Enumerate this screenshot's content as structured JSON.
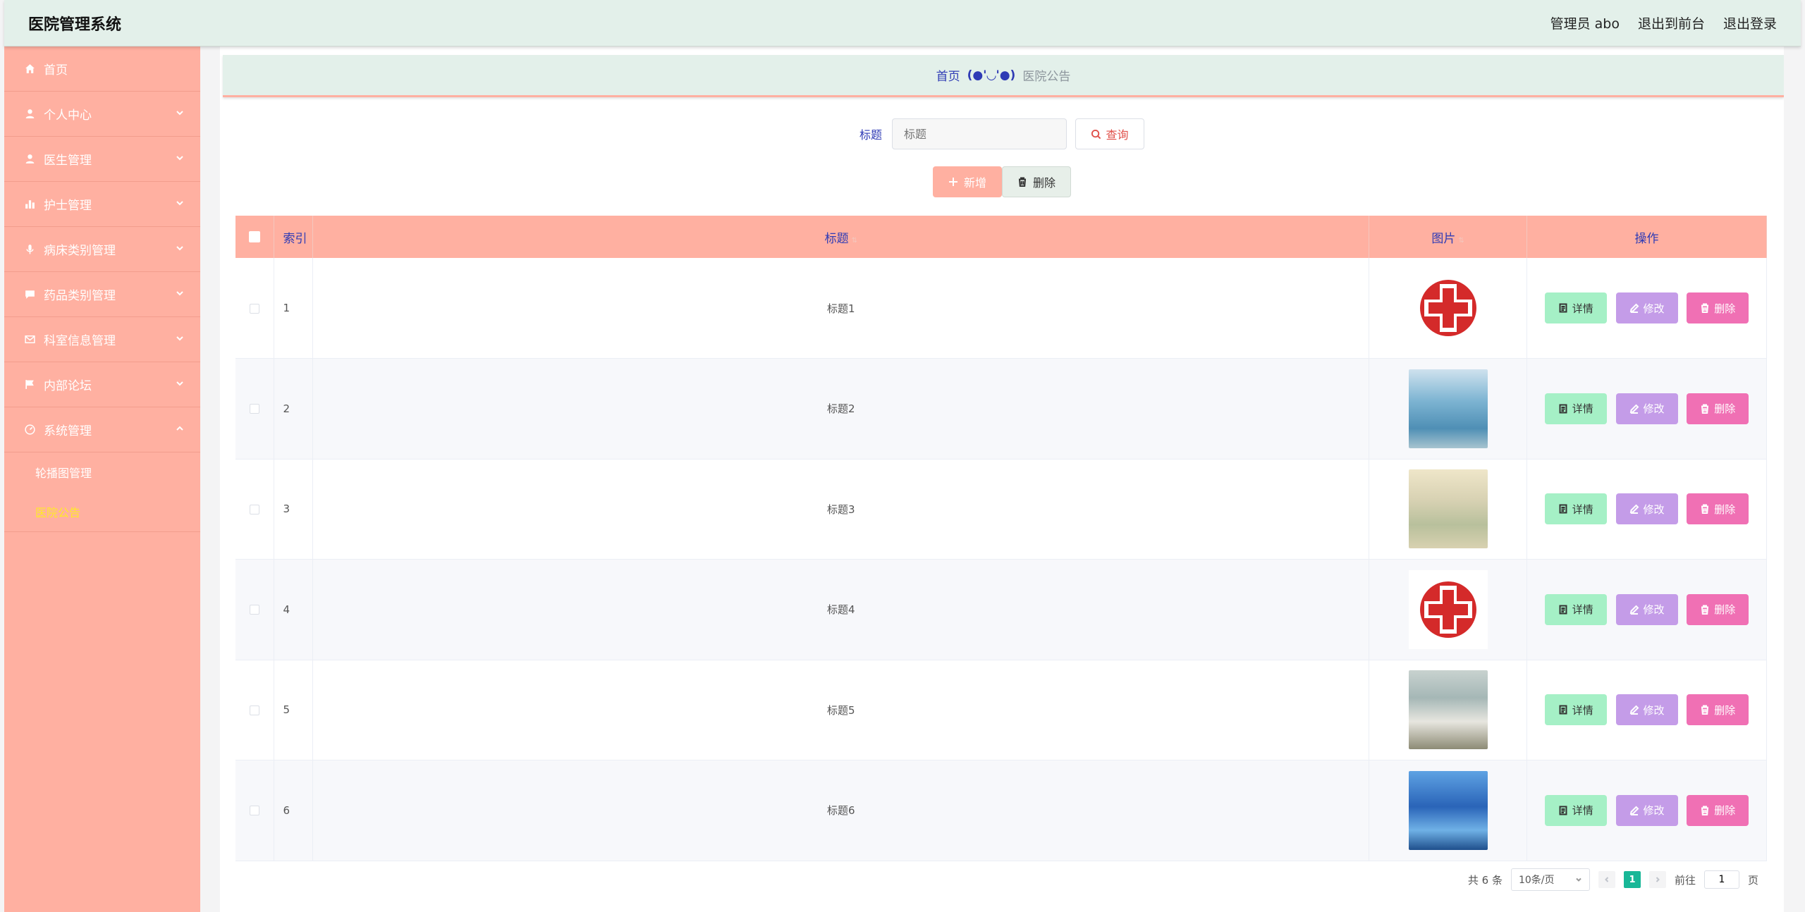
{
  "header": {
    "logo": "医院管理系统",
    "user": "管理员 abo",
    "to_front": "退出到前台",
    "logout": "退出登录"
  },
  "sidebar": {
    "items": [
      {
        "label": "首页",
        "icon": "home-icon"
      },
      {
        "label": "个人中心",
        "icon": "user-icon"
      },
      {
        "label": "医生管理",
        "icon": "user-icon"
      },
      {
        "label": "护士管理",
        "icon": "bar-chart-icon"
      },
      {
        "label": "病床类别管理",
        "icon": "microphone-icon"
      },
      {
        "label": "药品类别管理",
        "icon": "chat-icon"
      },
      {
        "label": "科室信息管理",
        "icon": "mail-icon"
      },
      {
        "label": "内部论坛",
        "icon": "flag-icon"
      },
      {
        "label": "系统管理",
        "icon": "gauge-icon"
      }
    ],
    "submenu": [
      {
        "label": "轮播图管理"
      },
      {
        "label": "医院公告"
      }
    ]
  },
  "breadcrumb": {
    "home": "首页",
    "separator": "(●'◡'●)",
    "current": "医院公告"
  },
  "search": {
    "label": "标题",
    "placeholder": "标题",
    "button": "查询"
  },
  "actions": {
    "add": "新增",
    "delete": "删除"
  },
  "table": {
    "headers": {
      "index": "索引",
      "title": "标题",
      "image": "图片",
      "operations": "操作"
    },
    "rows": [
      {
        "index": "1",
        "title": "标题1",
        "image": "red-cross-logo"
      },
      {
        "index": "2",
        "title": "标题2",
        "image": "operating-room-photo"
      },
      {
        "index": "3",
        "title": "标题3",
        "image": "hospital-corridor-photo"
      },
      {
        "index": "4",
        "title": "标题4",
        "image": "red-cross-logo"
      },
      {
        "index": "5",
        "title": "标题5",
        "image": "ward-room-photo"
      },
      {
        "index": "6",
        "title": "标题6",
        "image": "surgery-room-photo"
      }
    ],
    "ops": {
      "detail": "详情",
      "edit": "修改",
      "delete": "删除"
    }
  },
  "pagination": {
    "total": "共 6 条",
    "page_size": "10条/页",
    "current_page": "1",
    "goto_prefix": "前往",
    "goto_value": "1",
    "goto_suffix": "页"
  },
  "colors": {
    "accent": "#ffb0a1",
    "header_bg": "#e3f0ea",
    "text_blue": "#2f3bb5",
    "active_page": "#18b797",
    "detail_btn": "#a5f0c6",
    "edit_btn": "#c49ce8",
    "delete_btn": "#f070b4"
  }
}
